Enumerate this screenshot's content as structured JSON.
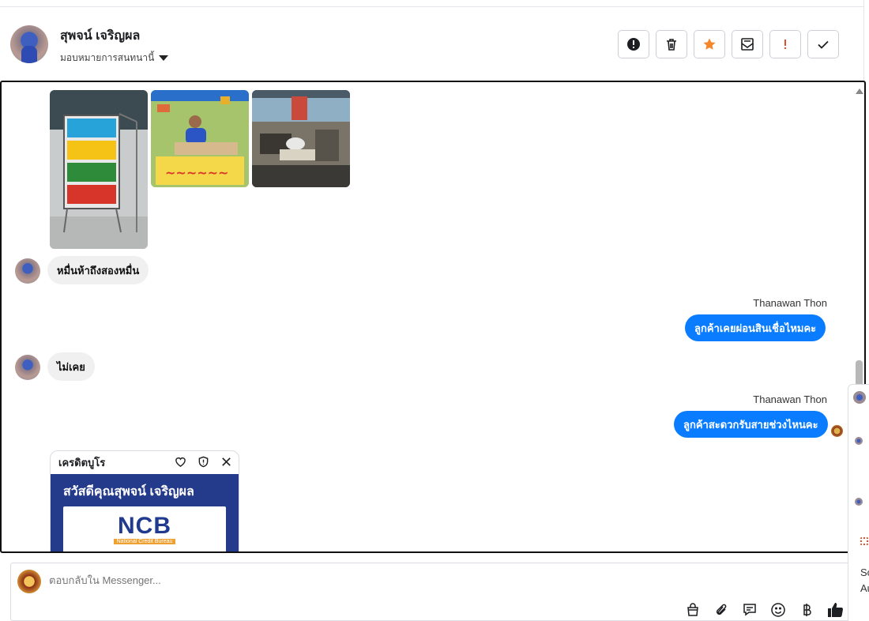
{
  "header": {
    "contact_name": "สุพจน์ เจริญผล",
    "assign_label": "มอบหมายการสนทนานี้",
    "actions": [
      {
        "name": "alert-icon",
        "label": "Report"
      },
      {
        "name": "trash-icon",
        "label": "Delete"
      },
      {
        "name": "star-icon",
        "label": "Star"
      },
      {
        "name": "mark-unread-icon",
        "label": "Mark unread"
      },
      {
        "name": "exclamation-icon",
        "label": "Important"
      },
      {
        "name": "check-icon",
        "label": "Done"
      }
    ]
  },
  "messages": [
    {
      "type": "incoming",
      "text": "หมื่นห้าถึงสองหมื่น"
    },
    {
      "type": "outgoing",
      "sender": "Thanawan Thon",
      "text": "ลูกค้าเคยผ่อนสินเชื่อไหมคะ"
    },
    {
      "type": "incoming",
      "text": "ไม่เคย"
    },
    {
      "type": "outgoing",
      "sender": "Thanawan Thon",
      "text": "ลูกค้าสะดวกรับสายช่วงไหนคะ"
    }
  ],
  "card": {
    "title": "เครดิตบูโร",
    "greeting": "สวัสดีคุณสุพจน์ เจริญผล",
    "logo_text": "NCB",
    "logo_sub": "National Credit Bureau"
  },
  "composer": {
    "placeholder": "ตอบกลับใน Messenger..."
  },
  "side_panel": {
    "line1": "So",
    "line2": "Au"
  },
  "colors": {
    "outgoing_bubble": "#0a7cff",
    "incoming_bubble": "#f0f0f0",
    "star": "#f5862b",
    "important": "#e0502a",
    "like": "#1c1e21"
  }
}
